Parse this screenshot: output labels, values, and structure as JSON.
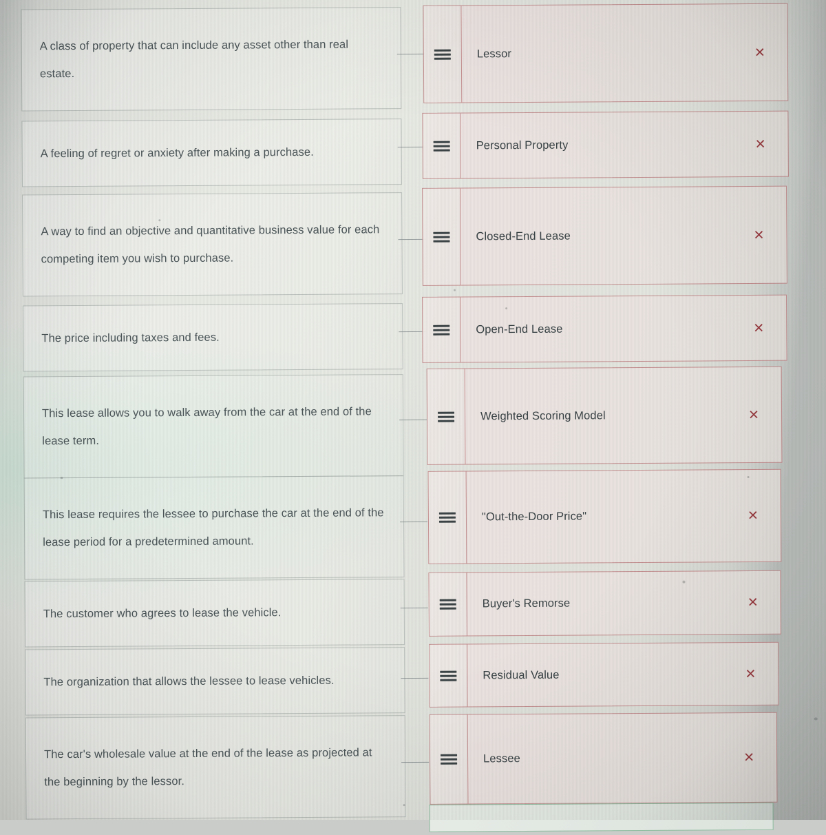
{
  "screen": {
    "kind": "matching-quiz",
    "background_color": "#e7e9e3",
    "accent_color": "#c48f90",
    "close_icon_color": "#98393e",
    "text_color": "#4b5558"
  },
  "prompts": [
    {
      "id": "p1",
      "text": "A class of property that can include any asset other than real estate."
    },
    {
      "id": "p2",
      "text": "A feeling of regret or anxiety after making a purchase."
    },
    {
      "id": "p3",
      "text": "A way to find an objective and quantitative business value for each competing item you wish to purchase."
    },
    {
      "id": "p4",
      "text": "The price including taxes and fees."
    },
    {
      "id": "p5",
      "text": "This lease allows you to walk away from the car at the end of the lease term."
    },
    {
      "id": "p6",
      "text": "This lease requires the lessee to purchase the car at the end of the lease period for a predetermined amount."
    },
    {
      "id": "p7",
      "text": "The customer who agrees to lease the vehicle."
    },
    {
      "id": "p8",
      "text": "The organization that allows the lessee to lease vehicles."
    },
    {
      "id": "p9",
      "text": "The car's wholesale value at the end of the lease as projected at the beginning by the lessor."
    }
  ],
  "answers": [
    {
      "id": "a1",
      "label": "Lessor",
      "drag_handle": "hamburger-icon",
      "remove": "×"
    },
    {
      "id": "a2",
      "label": "Personal Property",
      "drag_handle": "hamburger-icon",
      "remove": "×"
    },
    {
      "id": "a3",
      "label": "Closed-End Lease",
      "drag_handle": "hamburger-icon",
      "remove": "×"
    },
    {
      "id": "a4",
      "label": "Open-End Lease",
      "drag_handle": "hamburger-icon",
      "remove": "×"
    },
    {
      "id": "a5",
      "label": "Weighted Scoring Model",
      "drag_handle": "hamburger-icon",
      "remove": "×"
    },
    {
      "id": "a6",
      "label": "\"Out-the-Door Price\"",
      "drag_handle": "hamburger-icon",
      "remove": "×"
    },
    {
      "id": "a7",
      "label": "Buyer's Remorse",
      "drag_handle": "hamburger-icon",
      "remove": "×"
    },
    {
      "id": "a8",
      "label": "Residual Value",
      "drag_handle": "hamburger-icon",
      "remove": "×"
    },
    {
      "id": "a9",
      "label": "Lessee",
      "drag_handle": "hamburger-icon",
      "remove": "×"
    }
  ]
}
